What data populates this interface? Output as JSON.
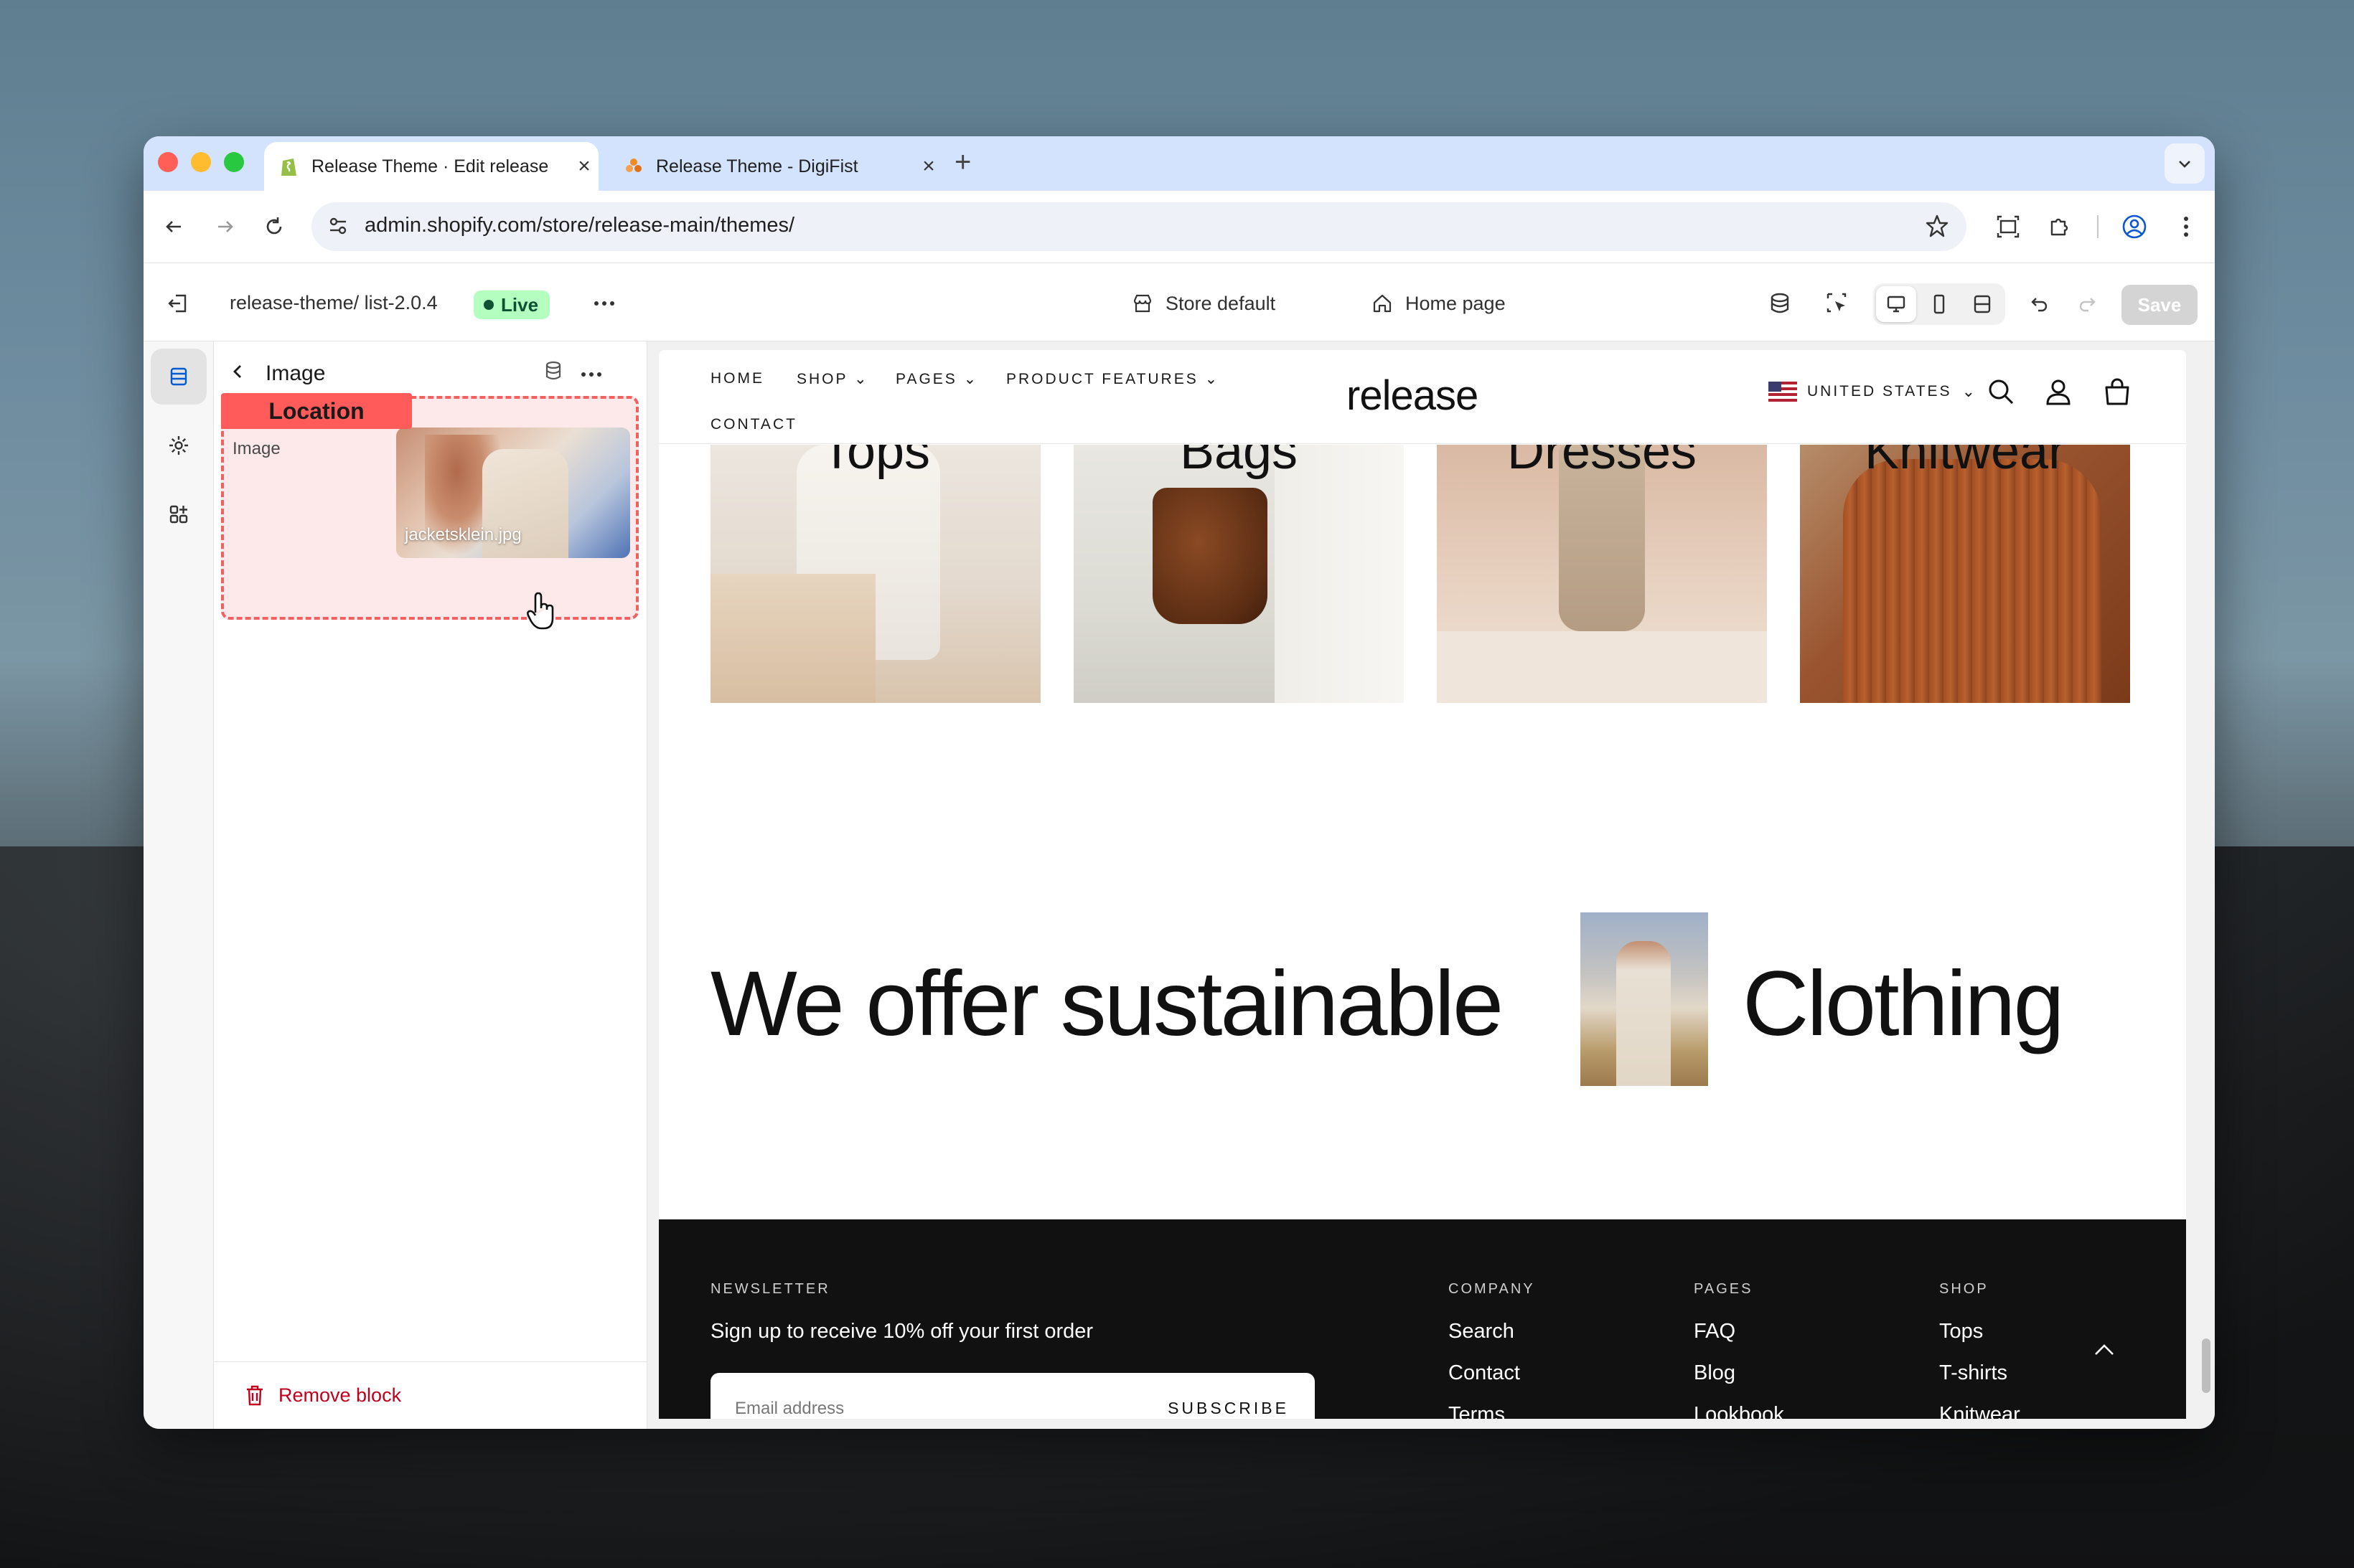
{
  "browser": {
    "tabs": [
      {
        "title": "Release Theme · Edit release",
        "active": true,
        "favicon": "shopify-icon"
      },
      {
        "title": "Release Theme - DigiFist",
        "active": false,
        "favicon": "digifist-icon"
      }
    ],
    "url": "admin.shopify.com/store/release-main/themes/"
  },
  "editor": {
    "theme_name": "release-theme/ list-2.0.4",
    "status_badge": "Live",
    "store_selector": "Store default",
    "page_selector": "Home page",
    "save_label": "Save"
  },
  "panel": {
    "title": "Image",
    "location_tag": "Location",
    "field_label": "Image",
    "image_filename": "jacketsklein.jpg",
    "remove_label": "Remove block"
  },
  "store": {
    "nav": [
      "HOME",
      "SHOP",
      "PAGES",
      "PRODUCT FEATURES",
      "CONTACT"
    ],
    "logo": "release",
    "country": "UNITED STATES",
    "categories": [
      "Tops",
      "Bags",
      "Dresses",
      "Knitwear"
    ],
    "hero_left": "We offer sustainable",
    "hero_right": "Clothing",
    "footer": {
      "newsletter_heading": "NEWSLETTER",
      "newsletter_text": "Sign up to receive 10% off your first order",
      "email_placeholder": "Email address",
      "subscribe_label": "SUBSCRIBE",
      "columns": [
        {
          "heading": "COMPANY",
          "links": [
            "Search",
            "Contact",
            "Terms"
          ]
        },
        {
          "heading": "PAGES",
          "links": [
            "FAQ",
            "Blog",
            "Lookbook"
          ]
        },
        {
          "heading": "SHOP",
          "links": [
            "Tops",
            "T-shirts",
            "Knitwear"
          ]
        }
      ]
    }
  },
  "colors": {
    "live_badge_bg": "#b4fec0",
    "location_tag": "#ff5b5b",
    "remove_red": "#c0001c",
    "footer_bg": "#111111"
  }
}
